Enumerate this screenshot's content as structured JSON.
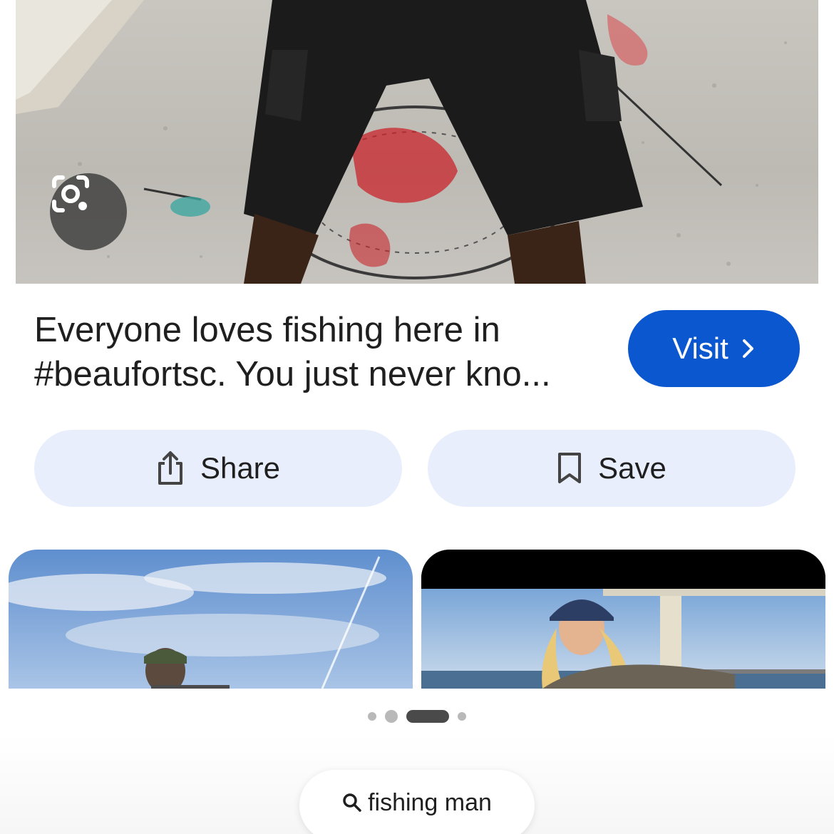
{
  "result": {
    "caption": "Everyone loves fishing here in #beaufortsc. You just never kno...",
    "visit_label": "Visit"
  },
  "actions": {
    "share_label": "Share",
    "save_label": "Save"
  },
  "pager": {
    "count": 4,
    "active_index": 2
  },
  "search_chip": {
    "query": "fishing man"
  },
  "colors": {
    "visit_button": "#0b57d0",
    "action_button": "#e8eefb",
    "text": "#1f1f1f"
  },
  "icons": [
    "google-lens-icon",
    "chevron-right-icon",
    "share-icon",
    "bookmark-icon",
    "search-icon"
  ]
}
